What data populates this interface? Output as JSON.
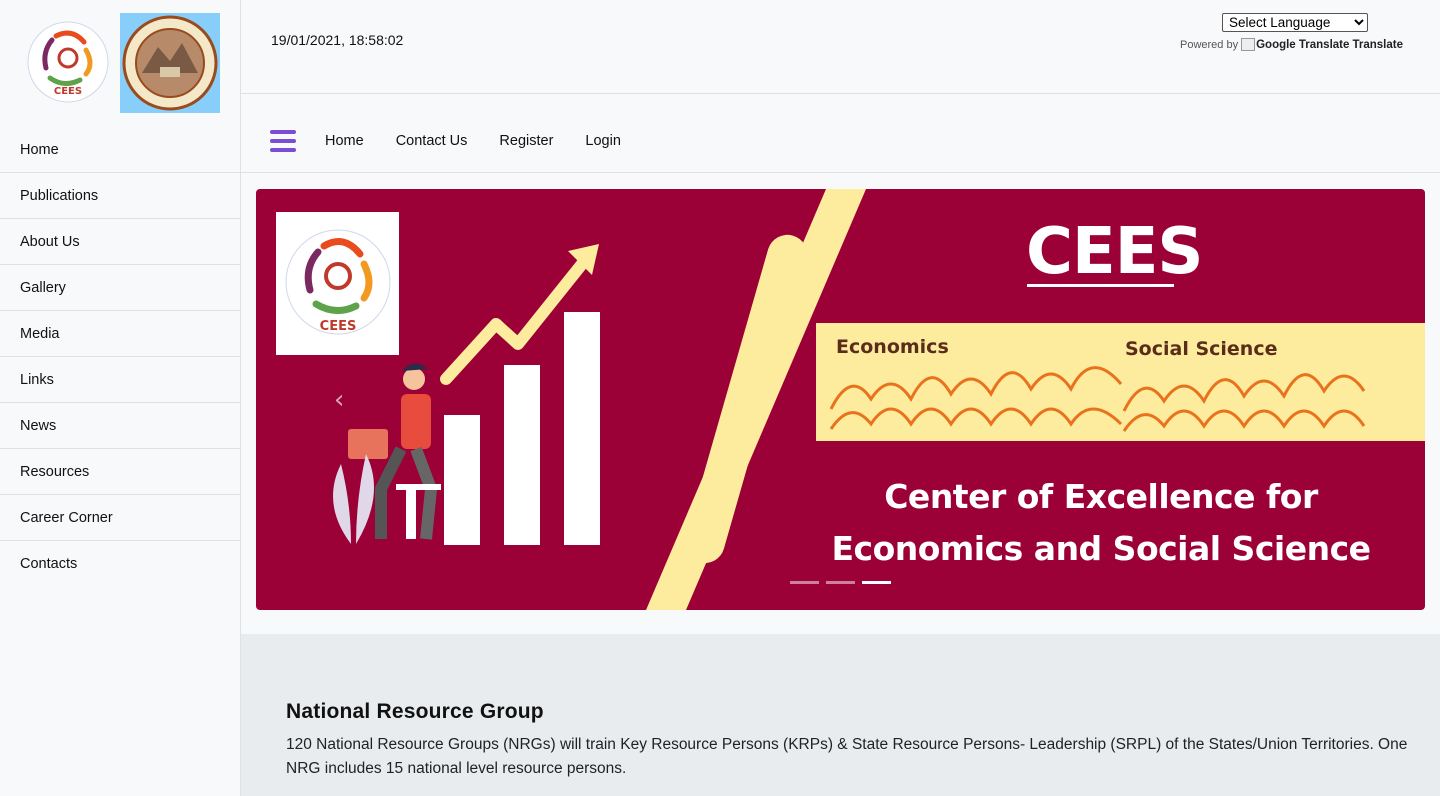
{
  "sidebar": {
    "items": [
      {
        "label": "Home"
      },
      {
        "label": "Publications"
      },
      {
        "label": "About Us"
      },
      {
        "label": "Gallery"
      },
      {
        "label": "Media"
      },
      {
        "label": "Links"
      },
      {
        "label": "News"
      },
      {
        "label": "Resources"
      },
      {
        "label": "Career Corner"
      },
      {
        "label": "Contacts"
      }
    ]
  },
  "header": {
    "datetime": "19/01/2021, 18:58:02",
    "language_select": "Select Language",
    "powered_by": "Powered by",
    "google_translate": "Google Translate",
    "translate": "Translate"
  },
  "navbar": {
    "links": [
      {
        "label": "Home"
      },
      {
        "label": "Contact Us"
      },
      {
        "label": "Register"
      },
      {
        "label": "Login"
      }
    ]
  },
  "carousel": {
    "title": "CEES",
    "label_economics": "Economics",
    "label_social_science": "Social Science",
    "caption": "Center of Excellence for Economics and Social Science",
    "slide_count": 3,
    "active_slide": 3,
    "logo_text": "CEES",
    "logo_ring_text": "Centre of Excellence for Economics and Social Science"
  },
  "section": {
    "heading": "National Resource Group",
    "body": "120 National Resource Groups (NRGs) will train Key Resource Persons (KRPs) & State Resource Persons- Leadership (SRPL) of the States/Union Territories. One NRG includes 15 national level resource persons."
  },
  "colors": {
    "accent": "#7b4cd4",
    "banner": "#9b0036",
    "banner_stripe": "#fdeb9e"
  }
}
